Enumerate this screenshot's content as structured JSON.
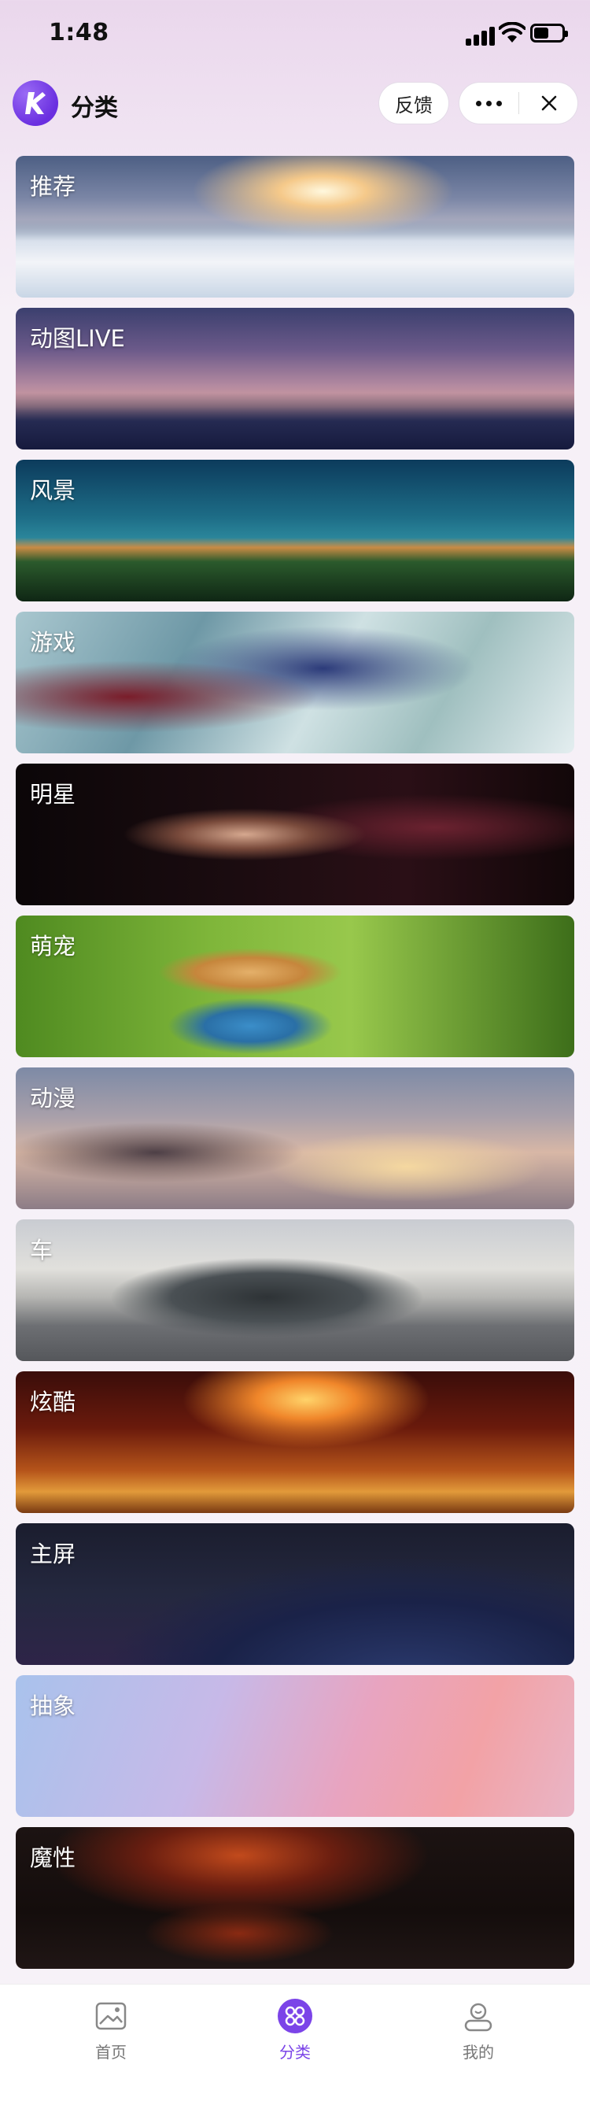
{
  "status_bar": {
    "time": "1:48"
  },
  "header": {
    "title": "分类",
    "feedback_label": "反馈",
    "icons": [
      "app-logo-icon",
      "more-icon",
      "close-icon"
    ]
  },
  "categories": [
    {
      "label": "推荐"
    },
    {
      "label": "动图LIVE"
    },
    {
      "label": "风景"
    },
    {
      "label": "游戏"
    },
    {
      "label": "明星"
    },
    {
      "label": "萌宠"
    },
    {
      "label": "动漫"
    },
    {
      "label": "车"
    },
    {
      "label": "炫酷"
    },
    {
      "label": "主屏"
    },
    {
      "label": "抽象"
    },
    {
      "label": "魔性"
    }
  ],
  "tabbar": {
    "tabs": [
      {
        "label": "首页",
        "icon": "image-icon",
        "active": false
      },
      {
        "label": "分类",
        "icon": "category-icon",
        "active": true
      },
      {
        "label": "我的",
        "icon": "profile-icon",
        "active": false
      }
    ],
    "accent_color": "#7b44e8"
  }
}
